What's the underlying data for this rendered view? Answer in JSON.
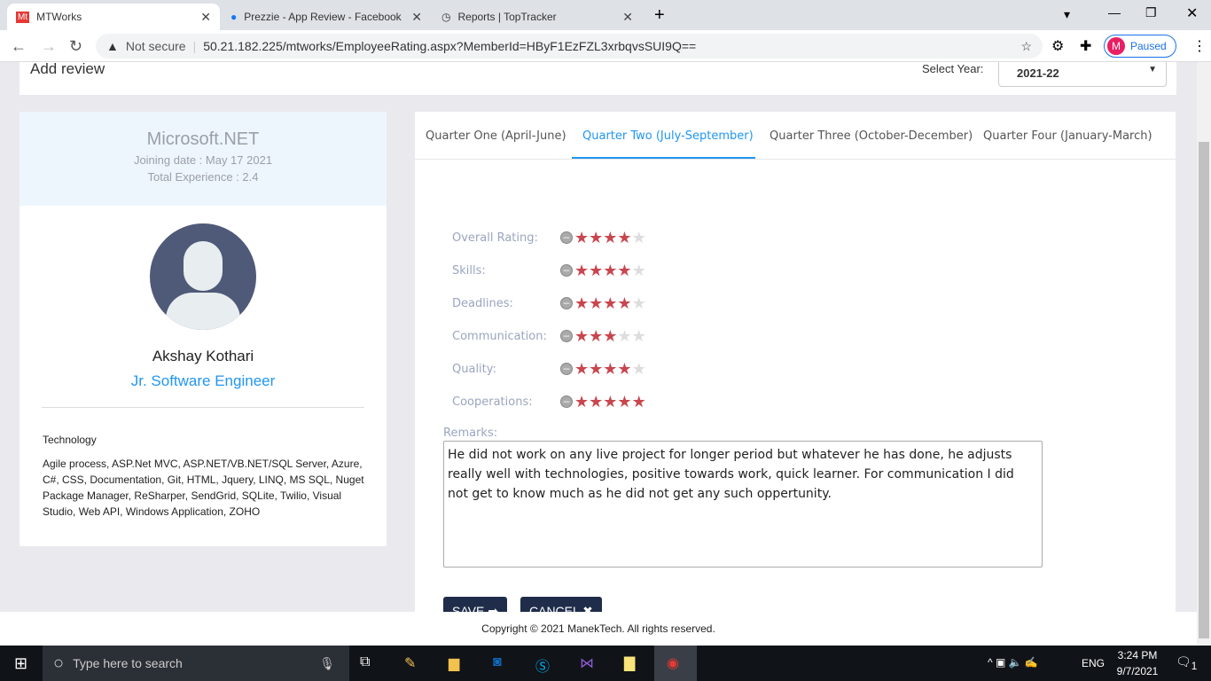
{
  "browser": {
    "tabs": [
      {
        "title": "MTWorks",
        "icon": "Mt"
      },
      {
        "title": "Prezzie - App Review - Facebook"
      },
      {
        "title": "Reports | TopTracker"
      }
    ],
    "security": "Not secure",
    "url": "50.21.182.225/mtworks/EmployeeRating.aspx?MemberId=HByF1EzFZL3xrbqvsSUI9Q==",
    "profile": "M",
    "profile_status": "Paused"
  },
  "header": {
    "title": "Add review",
    "year_label": "Select Year:",
    "year": "2021-22"
  },
  "profile": {
    "tech_name": "Microsoft.NET",
    "joining": "Joining date : May 17 2021",
    "experience": "Total Experience : 2.4",
    "name": "Akshay Kothari",
    "role": "Jr. Software Engineer",
    "tech_label": "Technology",
    "technologies": "Agile process, ASP.Net MVC, ASP.NET/VB.NET/SQL Server, Azure, C#, CSS, Documentation, Git, HTML, Jquery, LINQ, MS SQL, Nuget Package Manager, ReSharper, SendGrid, SQLite, Twilio, Visual Studio, Web API, Windows Application, ZOHO"
  },
  "quarters": [
    "Quarter One (April-June)",
    "Quarter Two (July-September)",
    "Quarter Three (October-December)",
    "Quarter Four (January-March)"
  ],
  "active_quarter": 1,
  "ratings": [
    {
      "label": "Overall Rating:",
      "value": 4
    },
    {
      "label": "Skills:",
      "value": 4
    },
    {
      "label": "Deadlines:",
      "value": 4
    },
    {
      "label": "Communication:",
      "value": 3
    },
    {
      "label": "Quality:",
      "value": 4
    },
    {
      "label": "Cooperations:",
      "value": 5
    }
  ],
  "max_rating": 5,
  "remarks_label": "Remarks:",
  "remarks": "He did not work on any live project for longer period but whatever he has done, he adjusts really well with technologies, positive towards work, quick learner. For communication I did not get to know much as he did not get any such oppertunity.",
  "buttons": {
    "save": "SAVE ➡",
    "cancel": "CANCEL ✖"
  },
  "footer": "Copyright © 2021 ManekTech. All rights reserved.",
  "taskbar": {
    "search": "Type here to search",
    "lang": "ENG",
    "time": "3:24 PM",
    "date": "9/7/2021",
    "notifications": "1"
  }
}
